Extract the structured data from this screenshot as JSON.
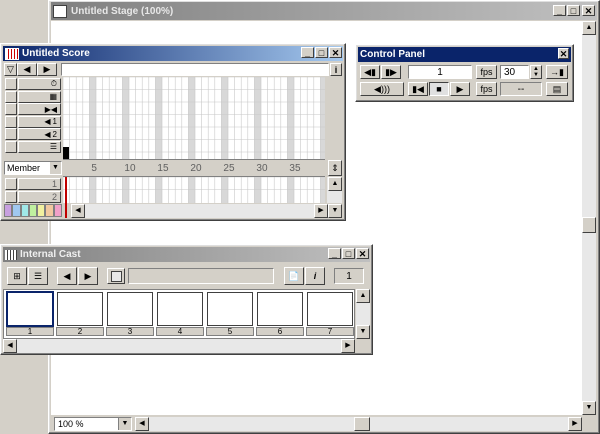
{
  "stage": {
    "title": "Untitled Stage (100%)",
    "zoom": "100 %"
  },
  "score": {
    "title": "Untitled Score",
    "sprite_select": "Member",
    "frame_labels": [
      "5",
      "10",
      "15",
      "20",
      "25",
      "30",
      "35"
    ],
    "channel_labels": [
      "1",
      "2"
    ],
    "sound_channels": [
      "1",
      "2"
    ]
  },
  "control_panel": {
    "title": "Control Panel",
    "frame": "1",
    "fps_label": "fps",
    "fps_value": "30",
    "tempo_label": "fps",
    "actual_fps": "--"
  },
  "cast": {
    "title": "Internal Cast",
    "member_number": "1",
    "cells": [
      "1",
      "2",
      "3",
      "4",
      "5",
      "6",
      "7"
    ]
  },
  "colors": {
    "active_title": "#0a246a",
    "inactive_title": "#808080",
    "playhead": "#c00000"
  }
}
